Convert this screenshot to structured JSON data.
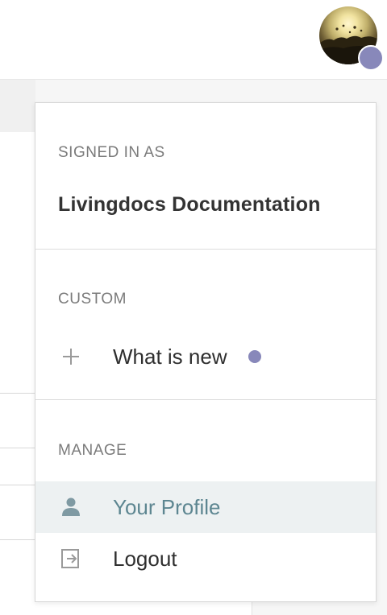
{
  "user_menu": {
    "signed_in_label": "SIGNED IN AS",
    "user_name": "Livingdocs Documentation",
    "custom_label": "CUSTOM",
    "custom_items": [
      {
        "label": "What is new",
        "icon": "plus-icon",
        "has_indicator": true
      }
    ],
    "manage_label": "MANAGE",
    "manage_items": [
      {
        "label": "Your Profile",
        "icon": "user-icon",
        "active": true
      },
      {
        "label": "Logout",
        "icon": "logout-icon",
        "active": false
      }
    ]
  },
  "colors": {
    "accent": "#8888ba",
    "active_text": "#5d8691",
    "active_bg": "#edf1f2"
  }
}
